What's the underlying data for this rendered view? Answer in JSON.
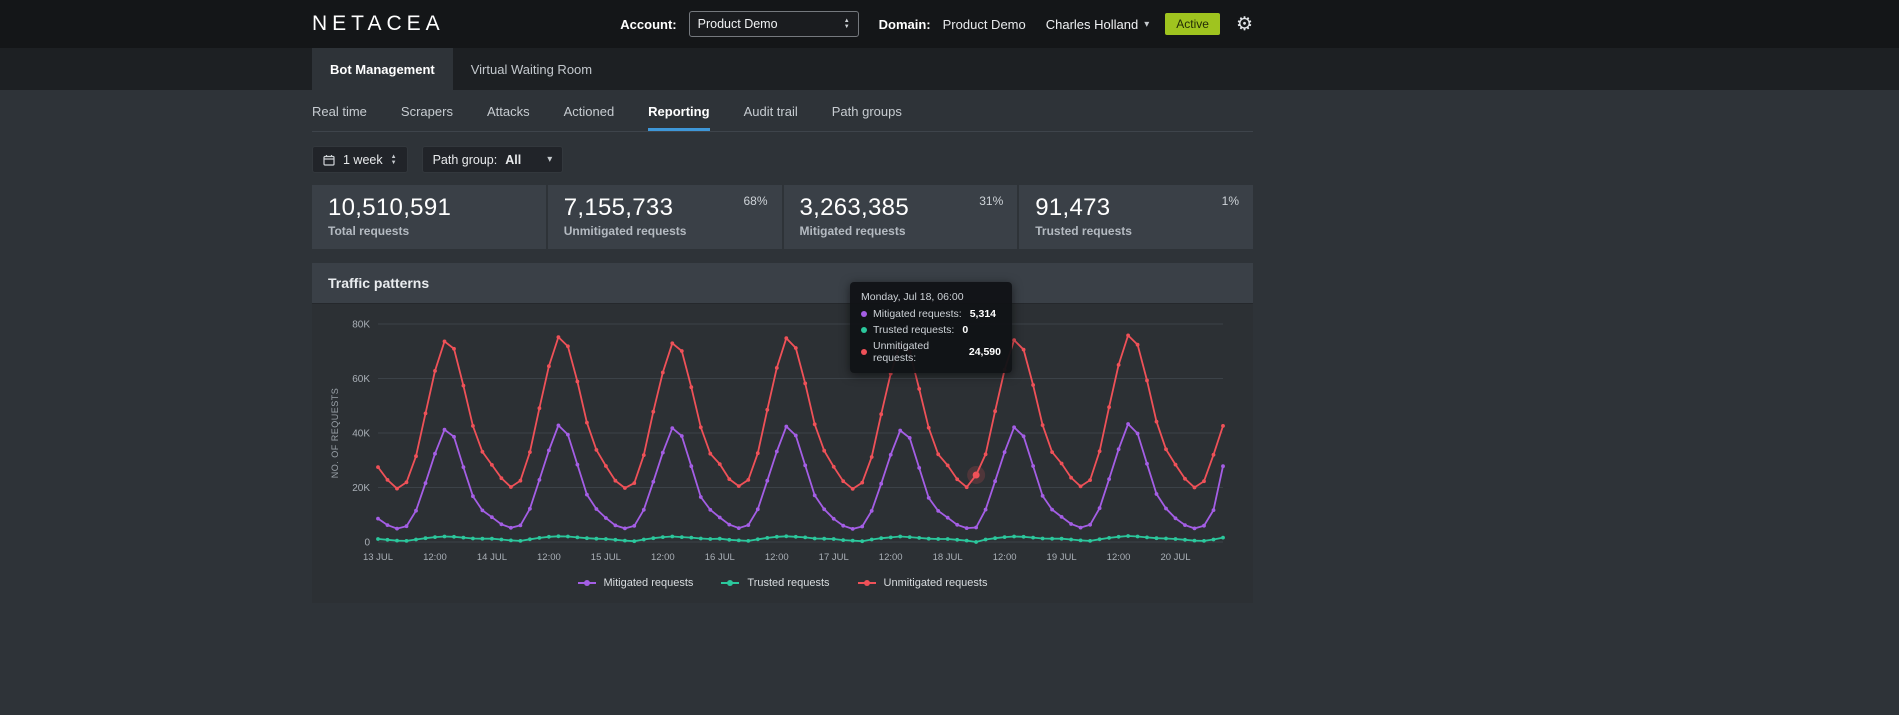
{
  "header": {
    "logo": "NETACEA",
    "account_label": "Account:",
    "account_value": "Product Demo",
    "domain_label": "Domain:",
    "domain_value": "Product Demo",
    "user_name": "Charles Holland",
    "status_badge": "Active"
  },
  "product_tabs": [
    {
      "label": "Bot Management",
      "active": true
    },
    {
      "label": "Virtual Waiting Room",
      "active": false
    }
  ],
  "nav_tabs": [
    {
      "label": "Real time",
      "active": false
    },
    {
      "label": "Scrapers",
      "active": false
    },
    {
      "label": "Attacks",
      "active": false
    },
    {
      "label": "Actioned",
      "active": false
    },
    {
      "label": "Reporting",
      "active": true
    },
    {
      "label": "Audit trail",
      "active": false
    },
    {
      "label": "Path groups",
      "active": false
    }
  ],
  "filters": {
    "time_range": "1 week",
    "path_group_label": "Path group:",
    "path_group_value": "All"
  },
  "stats": [
    {
      "value": "10,510,591",
      "label": "Total requests",
      "percent": ""
    },
    {
      "value": "7,155,733",
      "label": "Unmitigated requests",
      "percent": "68%"
    },
    {
      "value": "3,263,385",
      "label": "Mitigated requests",
      "percent": "31%"
    },
    {
      "value": "91,473",
      "label": "Trusted requests",
      "percent": "1%"
    }
  ],
  "panel": {
    "title": "Traffic patterns"
  },
  "tooltip": {
    "title": "Monday, Jul 18, 06:00",
    "rows": [
      {
        "label": "Mitigated requests:",
        "value": "5,314",
        "color": "#a45ee5"
      },
      {
        "label": "Trusted requests:",
        "value": "0",
        "color": "#2bc79c"
      },
      {
        "label": "Unmitigated requests:",
        "value": "24,590",
        "color": "#ef5158"
      }
    ]
  },
  "chart_data": {
    "type": "line",
    "title": "Traffic patterns",
    "ylabel": "NO. OF REQUESTS",
    "ylim": [
      0,
      80000
    ],
    "grid": "horizontal",
    "legend_position": "bottom",
    "x_start": "13 Jul 00:00",
    "x_step_hours": 2,
    "x_max_hours": 178,
    "y_ticks": [
      {
        "v": 0,
        "label": "0"
      },
      {
        "v": 20000,
        "label": "20K"
      },
      {
        "v": 40000,
        "label": "40K"
      },
      {
        "v": 60000,
        "label": "60K"
      },
      {
        "v": 80000,
        "label": "80K"
      }
    ],
    "x_ticks": [
      {
        "h": 0,
        "label": "13 JUL"
      },
      {
        "h": 12,
        "label": "12:00"
      },
      {
        "h": 24,
        "label": "14 JUL"
      },
      {
        "h": 36,
        "label": "12:00"
      },
      {
        "h": 48,
        "label": "15 JUL"
      },
      {
        "h": 60,
        "label": "12:00"
      },
      {
        "h": 72,
        "label": "16 JUL"
      },
      {
        "h": 84,
        "label": "12:00"
      },
      {
        "h": 96,
        "label": "17 JUL"
      },
      {
        "h": 108,
        "label": "12:00"
      },
      {
        "h": 120,
        "label": "18 JUL"
      },
      {
        "h": 132,
        "label": "12:00"
      },
      {
        "h": 144,
        "label": "19 JUL"
      },
      {
        "h": 156,
        "label": "12:00"
      },
      {
        "h": 168,
        "label": "20 JUL"
      }
    ],
    "series": [
      {
        "name": "Mitigated requests",
        "color": "#a45ee5",
        "values": [
          8600,
          6200,
          4900,
          5800,
          11500,
          21600,
          32400,
          41200,
          38600,
          27500,
          16800,
          11600,
          9100,
          6500,
          5200,
          6100,
          12200,
          22800,
          33600,
          42800,
          39400,
          28400,
          17400,
          12100,
          8800,
          6100,
          5000,
          5900,
          11800,
          22100,
          32800,
          41800,
          38900,
          27800,
          16500,
          11800,
          9000,
          6400,
          5100,
          6200,
          12000,
          22500,
          33200,
          42400,
          39100,
          28100,
          17100,
          12000,
          8500,
          6000,
          4800,
          5700,
          11400,
          21400,
          32000,
          40900,
          38200,
          27200,
          16200,
          11400,
          8900,
          6300,
          5100,
          5314,
          11900,
          22300,
          33000,
          42100,
          38800,
          27900,
          16900,
          11900,
          9200,
          6600,
          5300,
          6300,
          12400,
          23100,
          34000,
          43300,
          39800,
          28700,
          17600,
          12300,
          8700,
          6200,
          5000,
          6000,
          11700,
          27800
        ]
      },
      {
        "name": "Trusted requests",
        "color": "#2bc79c",
        "values": [
          1100,
          800,
          500,
          400,
          900,
          1400,
          1800,
          2000,
          1900,
          1600,
          1300,
          1200,
          1200,
          900,
          600,
          400,
          1000,
          1500,
          1900,
          2100,
          2000,
          1700,
          1400,
          1200,
          1100,
          800,
          500,
          300,
          900,
          1400,
          1800,
          2000,
          1800,
          1600,
          1300,
          1100,
          1200,
          800,
          600,
          400,
          1000,
          1500,
          1900,
          2100,
          1900,
          1700,
          1300,
          1200,
          1100,
          700,
          500,
          300,
          900,
          1400,
          1700,
          2000,
          1800,
          1500,
          1200,
          1100,
          1100,
          800,
          500,
          0,
          900,
          1400,
          1800,
          2000,
          1900,
          1600,
          1300,
          1200,
          1200,
          900,
          600,
          400,
          1000,
          1500,
          1900,
          2200,
          2000,
          1700,
          1400,
          1300,
          1100,
          800,
          500,
          400,
          900,
          1600
        ]
      },
      {
        "name": "Unmitigated requests",
        "color": "#ef5158",
        "values": [
          27500,
          22800,
          19600,
          21900,
          31500,
          47200,
          62800,
          73600,
          70900,
          57400,
          42600,
          33100,
          28300,
          23400,
          20200,
          22500,
          33000,
          49100,
          64500,
          75200,
          71800,
          58900,
          43800,
          33800,
          27900,
          22500,
          19800,
          21600,
          31900,
          47800,
          62200,
          72900,
          70100,
          56800,
          42100,
          32400,
          28600,
          23100,
          20500,
          22800,
          32600,
          48500,
          63900,
          74800,
          71200,
          58200,
          43200,
          33500,
          27600,
          22300,
          19500,
          21800,
          31200,
          46900,
          61800,
          72500,
          69800,
          56200,
          41900,
          32200,
          28100,
          23000,
          20100,
          24590,
          32200,
          48000,
          63200,
          74100,
          70600,
          57600,
          42900,
          33000,
          28800,
          23600,
          20400,
          22700,
          33300,
          49500,
          65000,
          75800,
          72400,
          59300,
          44200,
          34000,
          28400,
          23200,
          20000,
          22300,
          32000,
          42600
        ]
      }
    ],
    "hover_point": {
      "series_index": 2,
      "point_index": 63
    }
  }
}
